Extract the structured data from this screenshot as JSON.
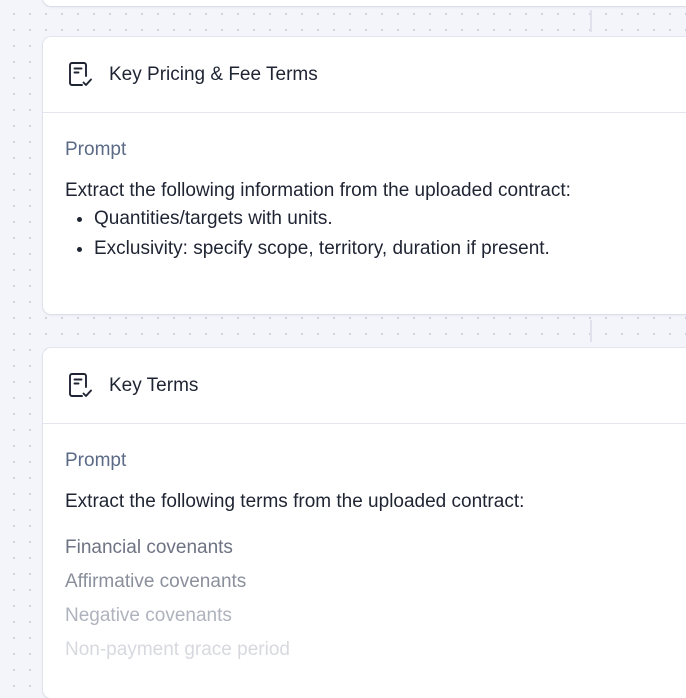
{
  "cards": [
    {
      "title": "Key Pricing & Fee Terms",
      "icon": "document-check-icon",
      "prompt_label": "Prompt",
      "intro": "Extract the following information from the uploaded contract:",
      "bullets": [
        "Quantities/targets with units.",
        "Exclusivity: specify scope, territory, duration if present."
      ]
    },
    {
      "title": "Key Terms",
      "icon": "document-check-icon",
      "prompt_label": "Prompt",
      "intro": "Extract the following terms from the uploaded contract:",
      "terms": [
        "Financial covenants",
        "Affirmative covenants",
        "Negative covenants",
        "Non-payment grace period"
      ]
    }
  ]
}
